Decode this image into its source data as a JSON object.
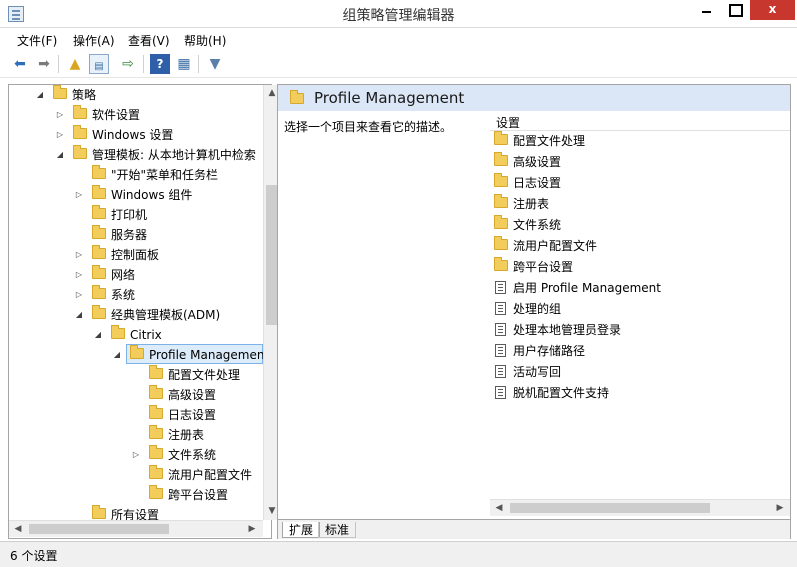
{
  "window": {
    "title": "组策略管理编辑器",
    "close_glyph": "x"
  },
  "menu": [
    "文件(F)",
    "操作(A)",
    "查看(V)",
    "帮助(H)"
  ],
  "toolbar_icons": [
    "back-arrow-icon",
    "forward-arrow-icon",
    "up-folder-icon",
    "show-hide-tree-icon",
    "export-list-icon",
    "help-icon",
    "properties-icon",
    "filter-icon"
  ],
  "tree": {
    "items": [
      {
        "label": "策略",
        "expander": "◢"
      },
      {
        "label": "软件设置",
        "expander": "▷"
      },
      {
        "label": "Windows 设置",
        "expander": "▷"
      },
      {
        "label": "管理模板: 从本地计算机中检索",
        "expander": "◢"
      },
      {
        "label": "\"开始\"菜单和任务栏",
        "expander": ""
      },
      {
        "label": "Windows 组件",
        "expander": "▷"
      },
      {
        "label": "打印机",
        "expander": ""
      },
      {
        "label": "服务器",
        "expander": ""
      },
      {
        "label": "控制面板",
        "expander": "▷"
      },
      {
        "label": "网络",
        "expander": "▷"
      },
      {
        "label": "系统",
        "expander": "▷"
      },
      {
        "label": "经典管理模板(ADM)",
        "expander": "◢"
      },
      {
        "label": "Citrix",
        "expander": "◢"
      },
      {
        "label": "Profile Management",
        "expander": "◢"
      },
      {
        "label": "配置文件处理",
        "expander": ""
      },
      {
        "label": "高级设置",
        "expander": ""
      },
      {
        "label": "日志设置",
        "expander": ""
      },
      {
        "label": "注册表",
        "expander": ""
      },
      {
        "label": "文件系统",
        "expander": "▷"
      },
      {
        "label": "流用户配置文件",
        "expander": ""
      },
      {
        "label": "跨平台设置",
        "expander": ""
      },
      {
        "label": "所有设置",
        "expander": ""
      }
    ]
  },
  "right": {
    "header_title": "Profile Management",
    "description": "选择一个项目来查看它的描述。",
    "column_header": "设置",
    "folders": [
      "配置文件处理",
      "高级设置",
      "日志设置",
      "注册表",
      "文件系统",
      "流用户配置文件",
      "跨平台设置"
    ],
    "settings": [
      "启用 Profile Management",
      "处理的组",
      "处理本地管理员登录",
      "用户存储路径",
      "活动写回",
      "脱机配置文件支持"
    ]
  },
  "tabs": [
    "扩展",
    "标准"
  ],
  "status": "6 个设置"
}
